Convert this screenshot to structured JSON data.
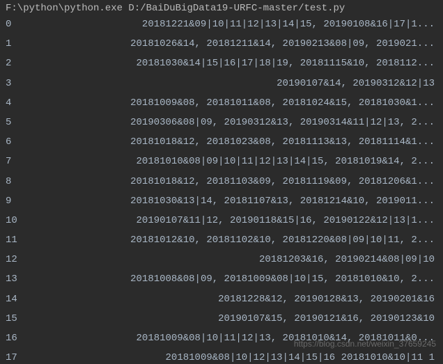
{
  "command": "F:\\python\\python.exe D:/BaiDuBigData19-URFC-master/test.py",
  "rows": [
    {
      "idx": "0",
      "data": "20181221&09|10|11|12|13|14|15, 20190108&16|17|1..."
    },
    {
      "idx": "1",
      "data": "20181026&14, 20181211&14, 20190213&08|09, 2019021..."
    },
    {
      "idx": "2",
      "data": "20181030&14|15|16|17|18|19, 20181115&10, 2018112..."
    },
    {
      "idx": "3",
      "data": "20190107&14, 20190312&12|13"
    },
    {
      "idx": "4",
      "data": "20181009&08, 20181011&08, 20181024&15, 20181030&1..."
    },
    {
      "idx": "5",
      "data": "20190306&08|09, 20190312&13, 20190314&11|12|13, 2..."
    },
    {
      "idx": "6",
      "data": "20181018&12, 20181023&08, 20181113&13, 20181114&1..."
    },
    {
      "idx": "7",
      "data": "20181010&08|09|10|11|12|13|14|15, 20181019&14, 2..."
    },
    {
      "idx": "8",
      "data": "20181018&12, 20181103&09, 20181119&09, 20181206&1..."
    },
    {
      "idx": "9",
      "data": "20181030&13|14, 20181107&13, 20181214&10, 2019011..."
    },
    {
      "idx": "10",
      "data": "20190107&11|12, 20190118&15|16, 20190122&12|13|1..."
    },
    {
      "idx": "11",
      "data": "20181012&10, 20181102&10, 20181220&08|09|10|11, 2..."
    },
    {
      "idx": "12",
      "data": "20181203&16, 20190214&08|09|10"
    },
    {
      "idx": "13",
      "data": "20181008&08|09, 20181009&08|10|15, 20181010&10, 2..."
    },
    {
      "idx": "14",
      "data": "20181228&12, 20190128&13, 20190201&16"
    },
    {
      "idx": "15",
      "data": "20190107&15, 20190121&16, 20190123&10"
    },
    {
      "idx": "16",
      "data": "20181009&08|10|11|12|13, 20181010&14, 20181011&0..."
    },
    {
      "idx": "17",
      "data": "20181009&08|10|12|13|14|15|16 20181010&10|11 1"
    }
  ],
  "watermark": "https://blog.csdn.net/weixin_37659245"
}
